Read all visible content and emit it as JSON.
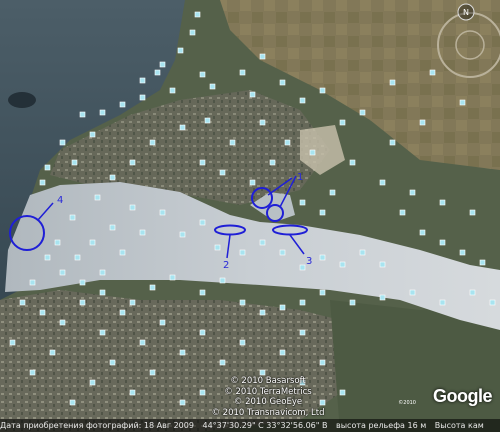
{
  "map": {
    "marker_color": "#1f1fd6",
    "pin_color": "#a8e4f0",
    "water_color": "#c4cbd0",
    "markers": [
      {
        "label": "1"
      },
      {
        "label": "2"
      },
      {
        "label": "3"
      },
      {
        "label": "4"
      }
    ]
  },
  "attribution": {
    "lines": [
      "© 2010 Basarsoft",
      "© 2010 TerraMetrics",
      "© 2010 GeoEye",
      "© 2010 Transnavicom, Ltd"
    ],
    "logo": "Google",
    "logo_small": "©2010"
  },
  "status_bar": {
    "imagery_date": "Дата приобретения фотографий: 18 Авг 2009",
    "coordinates": "44°37'30.29\" С   33°32'56.06\" В",
    "elevation": "высота рельефа   16 м",
    "eye_alt": "Высота кам"
  },
  "compass": {
    "icon": "compass-icon",
    "north_label": "N"
  }
}
